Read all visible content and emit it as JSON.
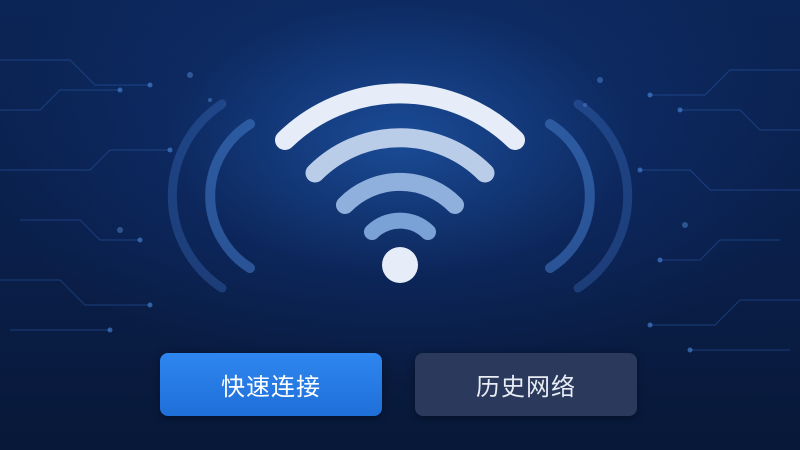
{
  "colors": {
    "background": "#0a1f4a",
    "wifi_icon": "#e8eef8",
    "primary_button": "#2a7de8",
    "secondary_button": "#2b3a5c"
  },
  "icons": {
    "wifi": "wifi-icon",
    "signal_waves_left": "signal-waves-icon",
    "signal_waves_right": "signal-waves-icon"
  },
  "buttons": {
    "quick_connect": "快速连接",
    "history_networks": "历史网络"
  }
}
